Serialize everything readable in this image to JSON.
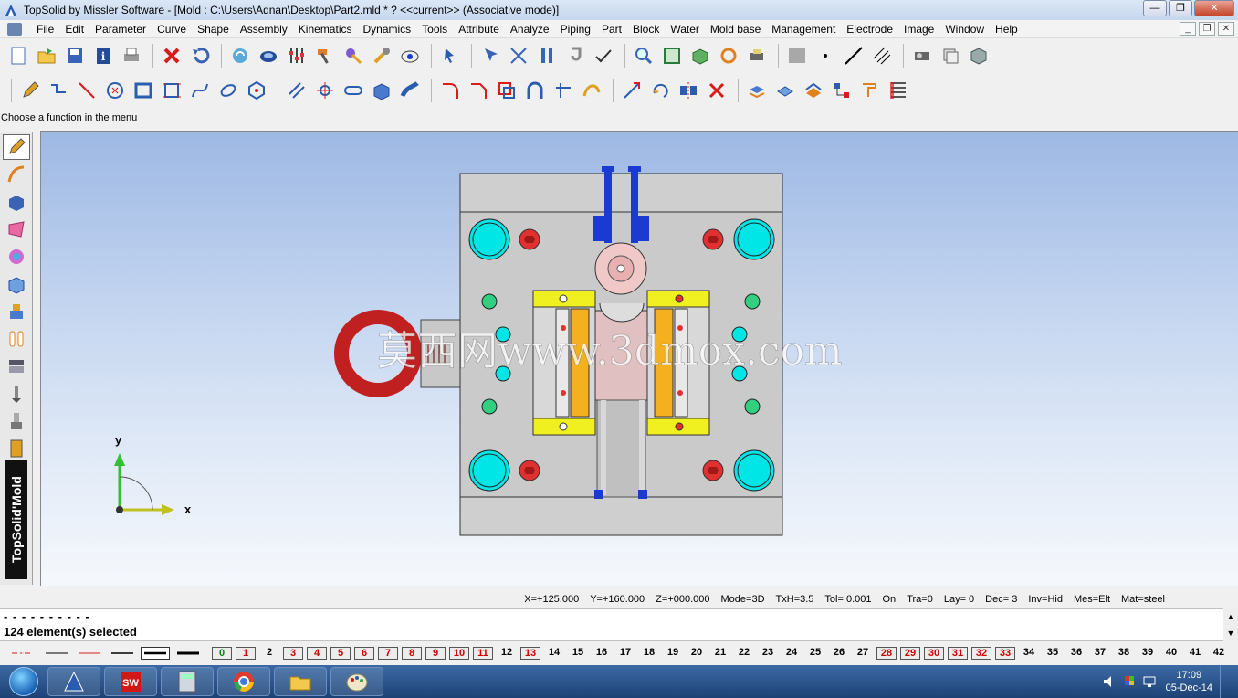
{
  "window": {
    "title": "TopSolid by Missler Software - [Mold : C:\\Users\\Adnan\\Desktop\\Part2.mld * ?  <<current>> (Associative mode)]",
    "minimize": "—",
    "maximize": "❐",
    "close": "✕"
  },
  "menu": {
    "items": [
      "File",
      "Edit",
      "Parameter",
      "Curve",
      "Shape",
      "Assembly",
      "Kinematics",
      "Dynamics",
      "Tools",
      "Attribute",
      "Analyze",
      "Piping",
      "Part",
      "Block",
      "Water",
      "Mold base",
      "Management",
      "Electrode",
      "Image",
      "Window",
      "Help"
    ],
    "mdi_min": "_",
    "mdi_restore": "❐",
    "mdi_close": "✕"
  },
  "hint": "Choose a function in the menu",
  "viewport": {
    "watermark": "莫西网www.3dmox.com",
    "axis_x": "x",
    "axis_y": "y",
    "colors": {
      "plate_gray": "#c8c8c8",
      "cyan": "#00e6e6",
      "bolt_red": "#e03030",
      "pin_green": "#30d080",
      "slider_yellow": "#f0f020",
      "slider_orange": "#f5b020",
      "hose_blue": "#1a3ad0",
      "eye_bolt": "#c02020"
    }
  },
  "status": {
    "x": "X=+125.000",
    "y": "Y=+160.000",
    "z": "Z=+000.000",
    "mode": "Mode=3D",
    "txh": "TxH=3.5",
    "tol": "Tol= 0.001",
    "on": "On",
    "tra": "Tra=0",
    "lay": "Lay=  0",
    "dec": "Dec= 3",
    "inv": "Inv=Hid",
    "mes": "Mes=Elt",
    "mat": "Mat=steel"
  },
  "messages": {
    "line1": "- - - - - - - - - -",
    "line2": "124 element(s) selected"
  },
  "layers": {
    "items": [
      {
        "n": "0",
        "state": "cur"
      },
      {
        "n": "1",
        "state": "on"
      },
      {
        "n": "2",
        "state": "off"
      },
      {
        "n": "3",
        "state": "on"
      },
      {
        "n": "4",
        "state": "on"
      },
      {
        "n": "5",
        "state": "on"
      },
      {
        "n": "6",
        "state": "on"
      },
      {
        "n": "7",
        "state": "on"
      },
      {
        "n": "8",
        "state": "on"
      },
      {
        "n": "9",
        "state": "on"
      },
      {
        "n": "10",
        "state": "on"
      },
      {
        "n": "11",
        "state": "on"
      },
      {
        "n": "12",
        "state": "off"
      },
      {
        "n": "13",
        "state": "on"
      },
      {
        "n": "14",
        "state": "off"
      },
      {
        "n": "15",
        "state": "off"
      },
      {
        "n": "16",
        "state": "off"
      },
      {
        "n": "17",
        "state": "off"
      },
      {
        "n": "18",
        "state": "off"
      },
      {
        "n": "19",
        "state": "off"
      },
      {
        "n": "20",
        "state": "off"
      },
      {
        "n": "21",
        "state": "off"
      },
      {
        "n": "22",
        "state": "off"
      },
      {
        "n": "23",
        "state": "off"
      },
      {
        "n": "24",
        "state": "off"
      },
      {
        "n": "25",
        "state": "off"
      },
      {
        "n": "26",
        "state": "off"
      },
      {
        "n": "27",
        "state": "off"
      },
      {
        "n": "28",
        "state": "on"
      },
      {
        "n": "29",
        "state": "on"
      },
      {
        "n": "30",
        "state": "on"
      },
      {
        "n": "31",
        "state": "on"
      },
      {
        "n": "32",
        "state": "on"
      },
      {
        "n": "33",
        "state": "on"
      },
      {
        "n": "34",
        "state": "off"
      },
      {
        "n": "35",
        "state": "off"
      },
      {
        "n": "36",
        "state": "off"
      },
      {
        "n": "37",
        "state": "off"
      },
      {
        "n": "38",
        "state": "off"
      },
      {
        "n": "39",
        "state": "off"
      },
      {
        "n": "40",
        "state": "off"
      },
      {
        "n": "41",
        "state": "off"
      },
      {
        "n": "42",
        "state": "off"
      }
    ]
  },
  "leftbar": {
    "brand": "TopSolid'Mold"
  },
  "taskbar": {
    "time": "17:09",
    "date": "05-Dec-14",
    "apps": [
      "topsolid-app",
      "solidworks-app",
      "calculator-app",
      "chrome-app",
      "file-explorer-app",
      "paint-app"
    ]
  }
}
